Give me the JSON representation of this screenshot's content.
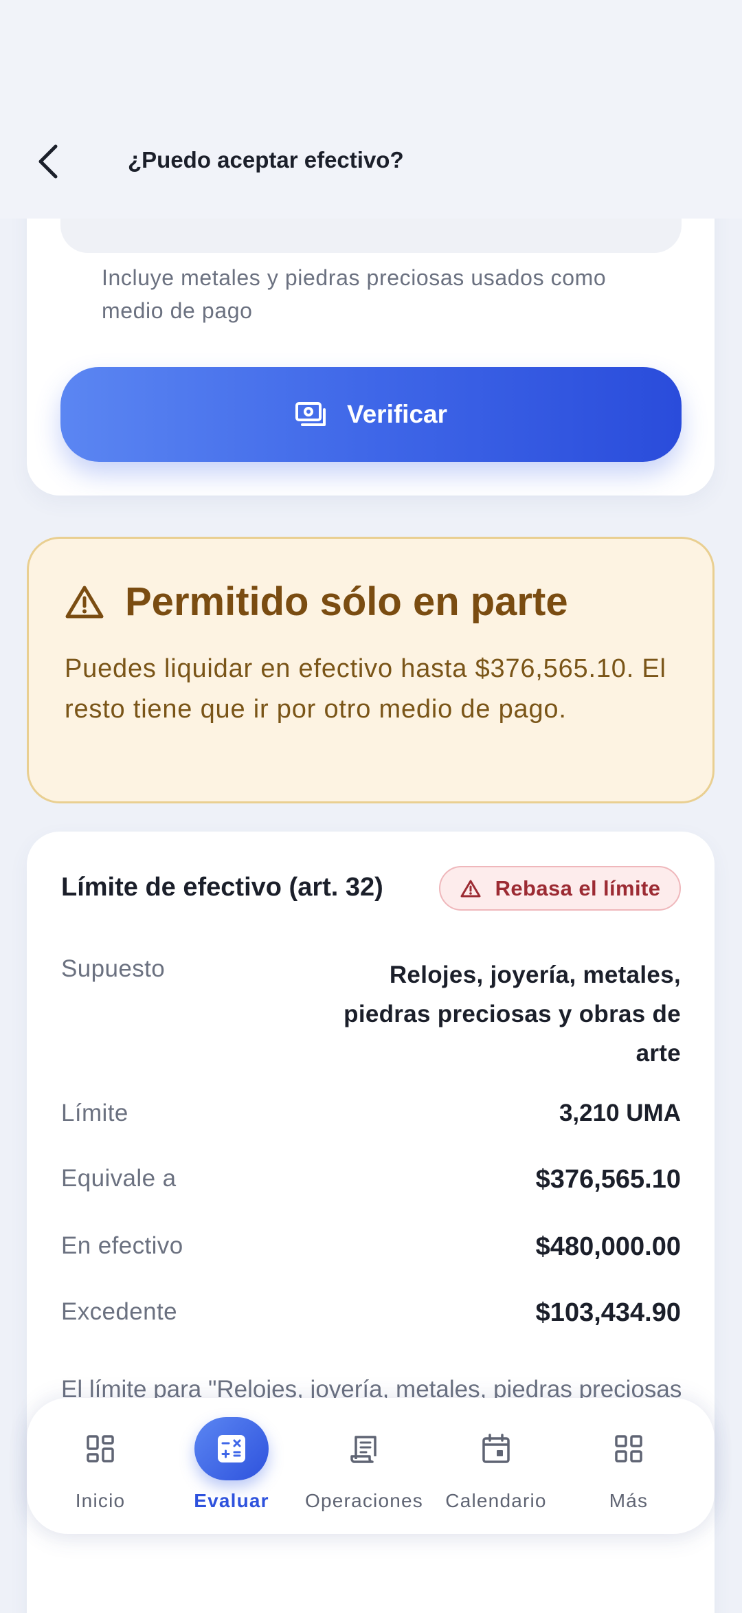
{
  "header": {
    "title": "¿Puedo aceptar efectivo?"
  },
  "form": {
    "helper_text": "Incluye metales y piedras preciosas usados como medio de pago",
    "verify_label": "Verificar"
  },
  "result": {
    "title": "Permitido sólo en parte",
    "message": "Puedes liquidar en efectivo hasta $376,565.10. El resto tiene que ir por otro medio de pago."
  },
  "limit": {
    "title": "Límite de efectivo (art. 32)",
    "badge": "Rebasa el límite",
    "rows": [
      {
        "label": "Supuesto",
        "value": "Relojes, joyería, metales, piedras preciosas y obras de arte"
      },
      {
        "label": "Límite",
        "value": "3,210 UMA"
      },
      {
        "label": "Equivale a",
        "value": "$376,565.10"
      },
      {
        "label": "En efectivo",
        "value": "$480,000.00"
      },
      {
        "label": "Excedente",
        "value": "$103,434.90"
      }
    ],
    "footnote": "El límite para \"Relojes, joyería, metales, piedras preciosas y obras de arte\""
  },
  "nav": {
    "items": [
      {
        "label": "Inicio",
        "icon": "dashboard-icon"
      },
      {
        "label": "Evaluar",
        "icon": "calculator-icon",
        "active": true
      },
      {
        "label": "Operaciones",
        "icon": "receipt-icon"
      },
      {
        "label": "Calendario",
        "icon": "calendar-icon"
      },
      {
        "label": "Más",
        "icon": "grid-icon"
      }
    ]
  },
  "colors": {
    "accent": "#3f67e8",
    "warning_bg": "#fdf3e2",
    "warning_text": "#7a4c11",
    "danger": "#9c2b33"
  }
}
